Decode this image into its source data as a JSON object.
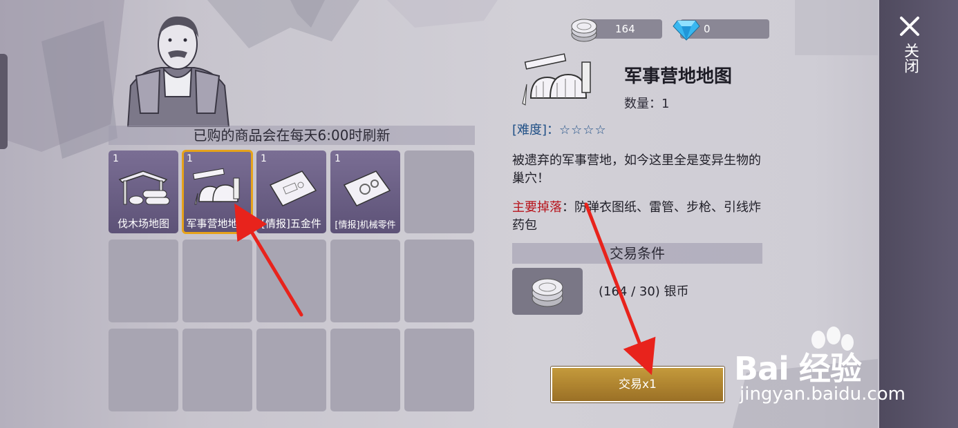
{
  "currency": {
    "silver": "164",
    "gems": "0"
  },
  "shop": {
    "refresh_notice": "已购的商品会在每天6:00时刷新",
    "items": [
      {
        "qty": "1",
        "name": "伐木场地图"
      },
      {
        "qty": "1",
        "name": "军事营地地图"
      },
      {
        "qty": "1",
        "name": "[情报]五金件"
      },
      {
        "qty": "1",
        "name": "[情报]机械零件"
      }
    ]
  },
  "detail": {
    "title": "军事营地地图",
    "quantity": "数量：1",
    "difficulty_label": "[难度]：",
    "difficulty_stars": "☆☆☆☆",
    "description": "被遗弃的军事营地，如今这里全是变异生物的巢穴！",
    "drops_label": "主要掉落",
    "drops_text": "：防弹衣图纸、雷管、步枪、引线炸药包",
    "trade_conditions": "交易条件",
    "trade_cost": "(164 / 30) 银币",
    "trade_button": "交易x1"
  },
  "panel": {
    "close_label": "关闭"
  },
  "watermark": {
    "main": "Bai 经验",
    "sub": "jingyan.baidu.com"
  },
  "colors": {
    "selected_outline": "#e6a21a",
    "drops_label": "#b7131b",
    "difficulty": "#1f4f86",
    "button_gold": "#b08530",
    "arrow_red": "#e8231c"
  }
}
